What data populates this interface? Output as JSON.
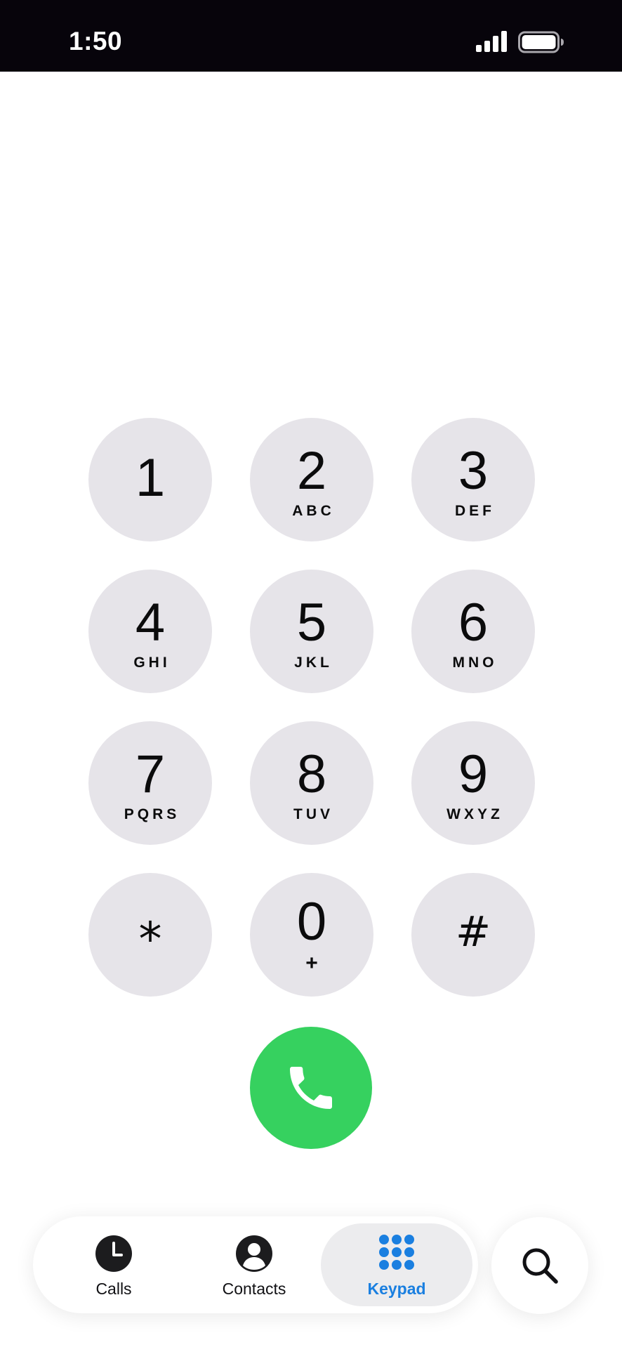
{
  "status_bar": {
    "time": "1:50",
    "signal_icon": "cellular-signal-icon",
    "battery_icon": "battery-icon"
  },
  "keypad": {
    "keys": [
      {
        "digit": "1",
        "letters": ""
      },
      {
        "digit": "2",
        "letters": "ABC"
      },
      {
        "digit": "3",
        "letters": "DEF"
      },
      {
        "digit": "4",
        "letters": "GHI"
      },
      {
        "digit": "5",
        "letters": "JKL"
      },
      {
        "digit": "6",
        "letters": "MNO"
      },
      {
        "digit": "7",
        "letters": "PQRS"
      },
      {
        "digit": "8",
        "letters": "TUV"
      },
      {
        "digit": "9",
        "letters": "WXYZ"
      },
      {
        "digit": "*",
        "letters": ""
      },
      {
        "digit": "0",
        "letters": "+"
      },
      {
        "digit": "#",
        "letters": ""
      }
    ],
    "key_color": "#e6e4e9"
  },
  "call_button": {
    "icon": "phone-icon",
    "color": "#36d15f"
  },
  "tab_bar": {
    "tabs": [
      {
        "label": "Calls",
        "icon": "clock-icon"
      },
      {
        "label": "Contacts",
        "icon": "person-circle-icon"
      },
      {
        "label": "Keypad",
        "icon": "keypad-grid-icon",
        "selected": true
      }
    ],
    "selected_color": "#1a7fe0"
  },
  "search": {
    "icon": "search-icon"
  }
}
